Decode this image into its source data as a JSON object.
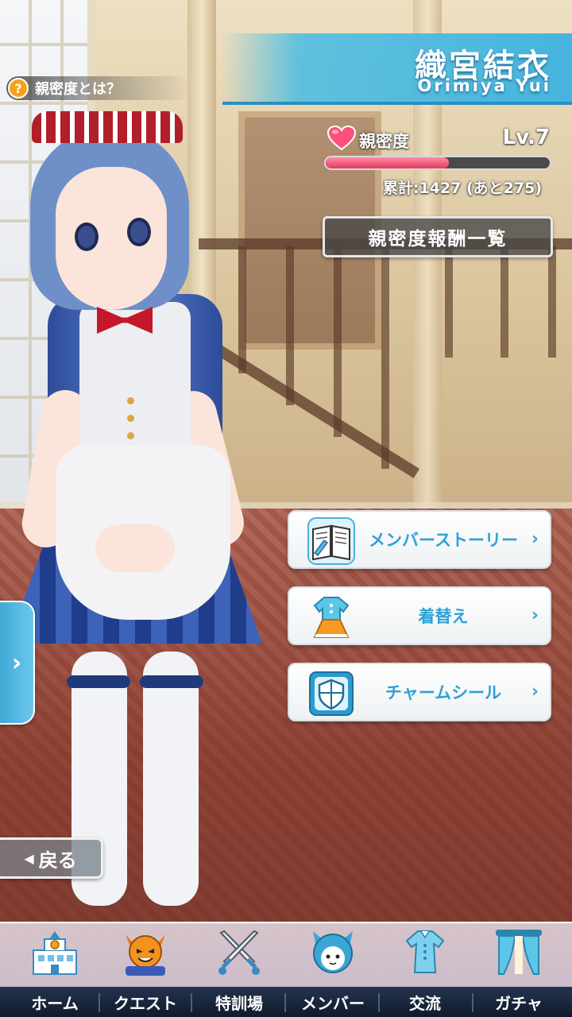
{
  "character": {
    "name_jp": "織宮結衣",
    "name_en": "Orimiya Yui"
  },
  "help": {
    "icon": "question-icon",
    "icon_glyph": "?",
    "label": "親密度とは？"
  },
  "affinity": {
    "label": "親密度",
    "level": "Lv.7",
    "progress": 0.55,
    "total_text": "累計:1427 (あと275)",
    "reward_button": "親密度報酬一覧"
  },
  "menu": [
    {
      "label": "メンバーストーリー",
      "icon": "book-icon",
      "chevron": "›"
    },
    {
      "label": "着替え",
      "icon": "dress-icon",
      "chevron": "›"
    },
    {
      "label": "チャームシール",
      "icon": "shield-icon",
      "chevron": "›"
    }
  ],
  "side_tab": {
    "glyph": "›"
  },
  "back": {
    "arrow": "◀",
    "label": "戻る"
  },
  "nav": {
    "items": [
      {
        "label": "ホーム",
        "icon": "school-building-icon"
      },
      {
        "label": "クエスト",
        "icon": "demon-icon"
      },
      {
        "label": "特訓場",
        "icon": "crossed-swords-icon"
      },
      {
        "label": "メンバー",
        "icon": "girl-face-icon"
      },
      {
        "label": "交流",
        "icon": "outfit-icon",
        "active": true
      },
      {
        "label": "ガチャ",
        "icon": "curtain-icon"
      }
    ]
  },
  "colors": {
    "accent": "#46b4de",
    "heart": "#ff4f7b",
    "bar_fill": "#e33a5d",
    "nav_bg": "#1a2740"
  }
}
